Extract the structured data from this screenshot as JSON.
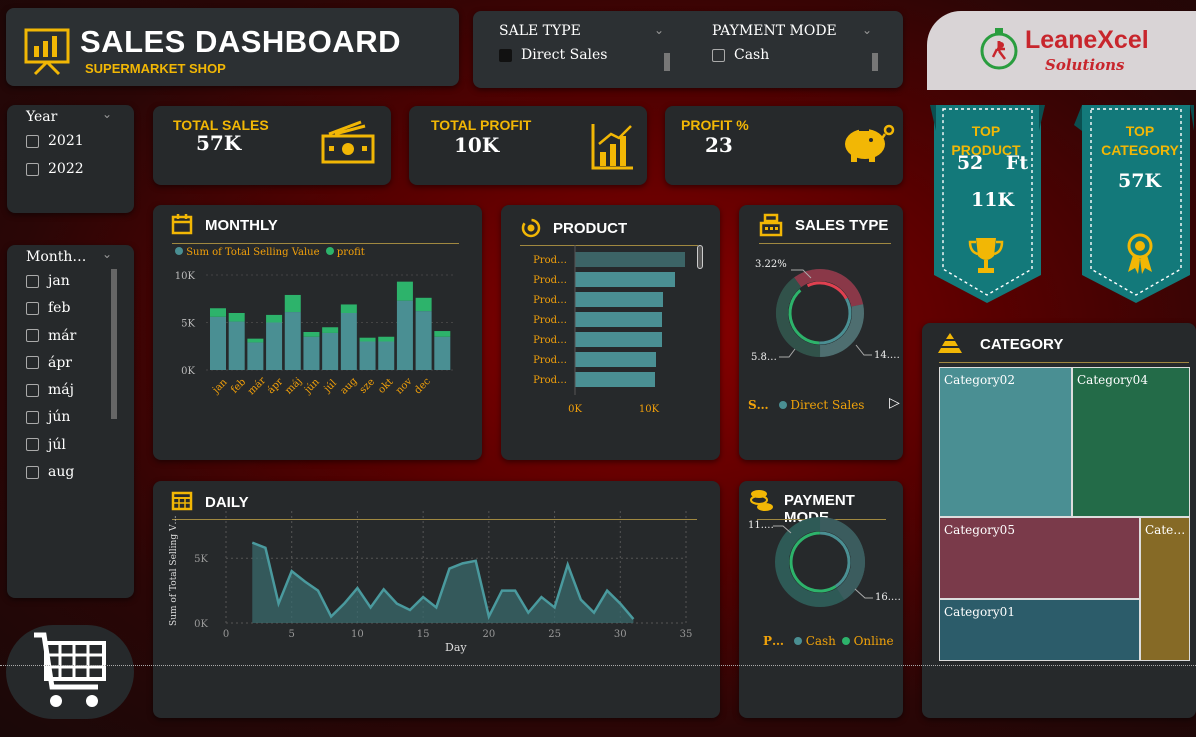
{
  "header": {
    "title": "SALES DASHBOARD",
    "subtitle": "SUPERMARKET SHOP"
  },
  "filters": {
    "sale_type": {
      "label": "SALE TYPE",
      "option": "Direct Sales"
    },
    "payment_mode": {
      "label": "PAYMENT MODE",
      "option": "Cash"
    }
  },
  "logo": {
    "line1": "LeaneXcel",
    "line2": "Solutions"
  },
  "year_slicer": {
    "label": "Year",
    "items": [
      "2021",
      "2022"
    ]
  },
  "month_slicer": {
    "label": "Month…",
    "items": [
      "jan",
      "feb",
      "már",
      "ápr",
      "máj",
      "jún",
      "júl",
      "aug"
    ]
  },
  "kpis": {
    "total_sales": {
      "label": "TOTAL SALES",
      "value": "57K"
    },
    "total_profit": {
      "label": "TOTAL PROFIT",
      "value": "10K"
    },
    "profit_pct": {
      "label": "PROFIT %",
      "value": "23"
    }
  },
  "top_product": {
    "label": "TOP PRODUCT",
    "name": "52 Ft",
    "value": "11K"
  },
  "top_category": {
    "label": "TOP CATEGORY",
    "value": "57K"
  },
  "monthly": {
    "title": "MONTHLY",
    "legend": [
      "Sum of Total Selling Value",
      "profit"
    ]
  },
  "product": {
    "title": "PRODUCT"
  },
  "sales_type": {
    "title": "SALES TYPE",
    "legend_prefix": "S…",
    "legend_item": "Direct Sales",
    "labels": {
      "small": "3.22%",
      "left": "5.8…",
      "right": "14.…"
    }
  },
  "daily": {
    "title": "DAILY"
  },
  "payment": {
    "title": "PAYMENT MODE",
    "legend_prefix": "P…",
    "legend_items": [
      "Cash",
      "Online"
    ],
    "labels": {
      "top": "11.…",
      "right": "16.…"
    }
  },
  "category": {
    "title": "CATEGORY"
  },
  "colors": {
    "teal": "#4a8f93",
    "green": "#2db36b",
    "gold": "#f2b705",
    "dark_card": "#26292b"
  },
  "chart_data": [
    {
      "type": "bar",
      "title": "MONTHLY",
      "categories": [
        "jan",
        "feb",
        "már",
        "ápr",
        "máj",
        "jún",
        "júl",
        "aug",
        "sze",
        "okt",
        "nov",
        "dec"
      ],
      "series": [
        {
          "name": "Sum of Total Selling Value",
          "values": [
            5600,
            5100,
            2900,
            5000,
            6100,
            3500,
            3900,
            6000,
            3000,
            3000,
            7300,
            6200,
            3500
          ]
        },
        {
          "name": "profit",
          "values": [
            900,
            900,
            400,
            800,
            1800,
            500,
            600,
            900,
            400,
            500,
            2000,
            1400,
            600
          ]
        }
      ],
      "ylim": [
        0,
        10000
      ],
      "yticks": [
        "0K",
        "5K",
        "10K"
      ]
    },
    {
      "type": "bar",
      "title": "PRODUCT",
      "orientation": "horizontal",
      "categories": [
        "Prod…",
        "Prod…",
        "Prod…",
        "Prod…",
        "Prod…",
        "Prod…",
        "Prod…"
      ],
      "values": [
        11000,
        10000,
        8800,
        8700,
        8700,
        8100,
        8000
      ],
      "xticks": [
        "0K",
        "10K"
      ]
    },
    {
      "type": "pie",
      "title": "SALES TYPE",
      "labels": [
        "small",
        "left",
        "right"
      ],
      "values": [
        3.22,
        5.8,
        14
      ]
    },
    {
      "type": "area",
      "title": "DAILY",
      "x": [
        2,
        3,
        4,
        5,
        6,
        7,
        8,
        9,
        10,
        11,
        12,
        13,
        14,
        15,
        16,
        17,
        18,
        19,
        20,
        21,
        22,
        23,
        24,
        25,
        26,
        27,
        28,
        29,
        30,
        31
      ],
      "values": [
        6200,
        5800,
        1500,
        4000,
        3200,
        2500,
        500,
        1500,
        2700,
        1200,
        2600,
        1500,
        1000,
        2000,
        1200,
        4200,
        4600,
        4800,
        500,
        2500,
        2500,
        800,
        2000,
        1200,
        4500,
        1800,
        800,
        2500,
        1500,
        300
      ],
      "xlabel": "Day",
      "ylabel": "Sum of Total Selling V…",
      "xticks": [
        "0",
        "5",
        "10",
        "15",
        "20",
        "25",
        "30",
        "35"
      ],
      "yticks": [
        "0K",
        "5K"
      ]
    },
    {
      "type": "pie",
      "title": "PAYMENT MODE",
      "labels": [
        "top",
        "right"
      ],
      "values": [
        11,
        16
      ]
    },
    {
      "type": "table",
      "title": "CATEGORY",
      "items": [
        "Category02",
        "Category04",
        "Category05",
        "Cate…",
        "Category01"
      ]
    }
  ]
}
